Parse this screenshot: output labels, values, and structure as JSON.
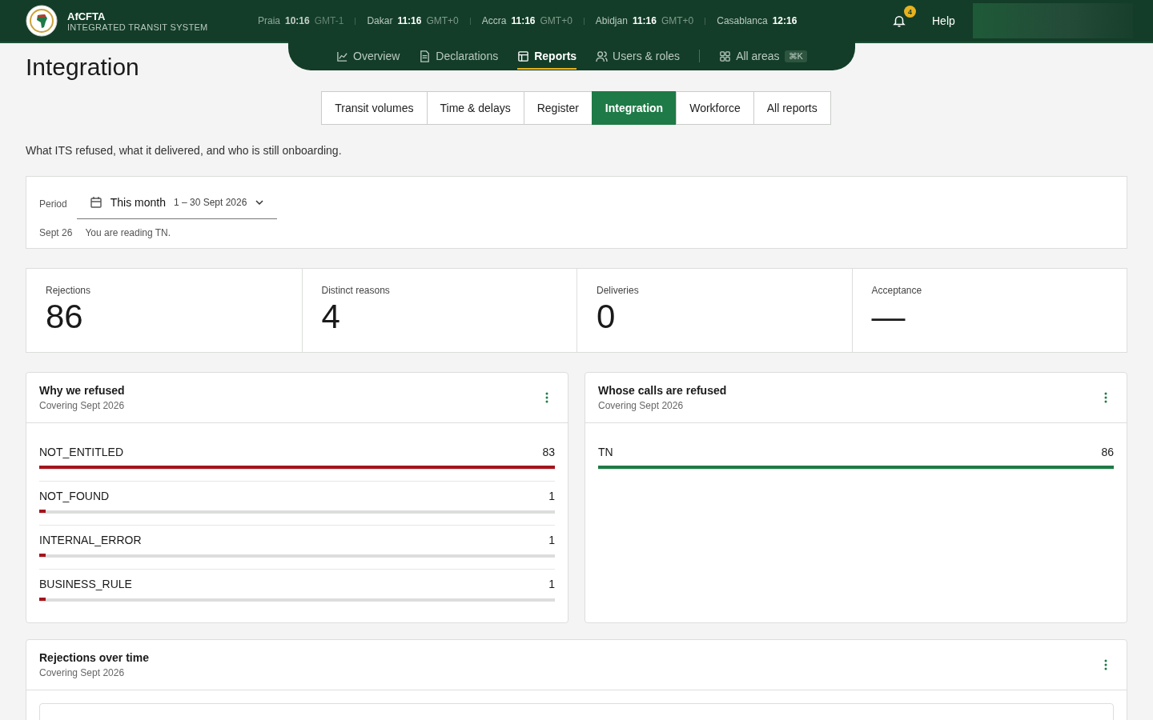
{
  "brand": {
    "name": "AfCFTA",
    "subtitle": "INTEGRATED TRANSIT SYSTEM"
  },
  "clocks": [
    {
      "city": "Praia",
      "time": "10:16",
      "zone": "GMT-1"
    },
    {
      "city": "Dakar",
      "time": "11:16",
      "zone": "GMT+0"
    },
    {
      "city": "Accra",
      "time": "11:16",
      "zone": "GMT+0"
    },
    {
      "city": "Abidjan",
      "time": "11:16",
      "zone": "GMT+0"
    },
    {
      "city": "Casablanca",
      "time": "12:16"
    }
  ],
  "notifications": {
    "count": "4"
  },
  "help": "Help",
  "nav": [
    {
      "label": "Overview",
      "kind": "chart",
      "selected": false
    },
    {
      "label": "Declarations",
      "kind": "doc",
      "selected": false
    },
    {
      "label": "Reports",
      "kind": "table",
      "selected": true
    },
    {
      "label": "Users & roles",
      "kind": "users",
      "selected": false
    },
    {
      "label": "All areas",
      "kind": "grid",
      "selected": false,
      "shortcut": "⌘K"
    }
  ],
  "page_title": "Integration",
  "tabs": [
    {
      "label": "Transit volumes",
      "selected": false
    },
    {
      "label": "Time & delays",
      "selected": false
    },
    {
      "label": "Register",
      "selected": false
    },
    {
      "label": "Integration",
      "selected": true
    },
    {
      "label": "Workforce",
      "selected": false
    },
    {
      "label": "All reports",
      "selected": false
    }
  ],
  "intro": "What ITS refused, what it delivered, and who is still onboarding.",
  "period": {
    "label": "Period",
    "value": "This month",
    "range": "1 – 30 Sept 2026",
    "date": "Sept 26",
    "note": "You are reading TN."
  },
  "stats": [
    {
      "label": "Rejections",
      "value": "86"
    },
    {
      "label": "Distinct reasons",
      "value": "4"
    },
    {
      "label": "Deliveries",
      "value": "0"
    },
    {
      "label": "Acceptance",
      "value": "—"
    }
  ],
  "panels": [
    {
      "title": "Why we refused",
      "subtitle": "Covering Sept 2026",
      "rows": [
        {
          "name": "NOT_ENTITLED",
          "count": "83",
          "level": 1,
          "color": "#a3141c"
        },
        {
          "name": "NOT_FOUND",
          "count": "1",
          "level": 0.012,
          "color": "#a3141c"
        },
        {
          "name": "INTERNAL_ERROR",
          "count": "1",
          "level": 0.012,
          "color": "#a3141c"
        },
        {
          "name": "BUSINESS_RULE",
          "count": "1",
          "level": 0.012,
          "color": "#a3141c"
        }
      ]
    },
    {
      "title": "Whose calls are refused",
      "subtitle": "Covering Sept 2026",
      "rows": [
        {
          "name": "TN",
          "count": "86",
          "level": 1,
          "color": "#1e7a46"
        }
      ]
    }
  ],
  "timeline": {
    "title": "Rejections over time",
    "subtitle": "Covering Sept 2026"
  }
}
